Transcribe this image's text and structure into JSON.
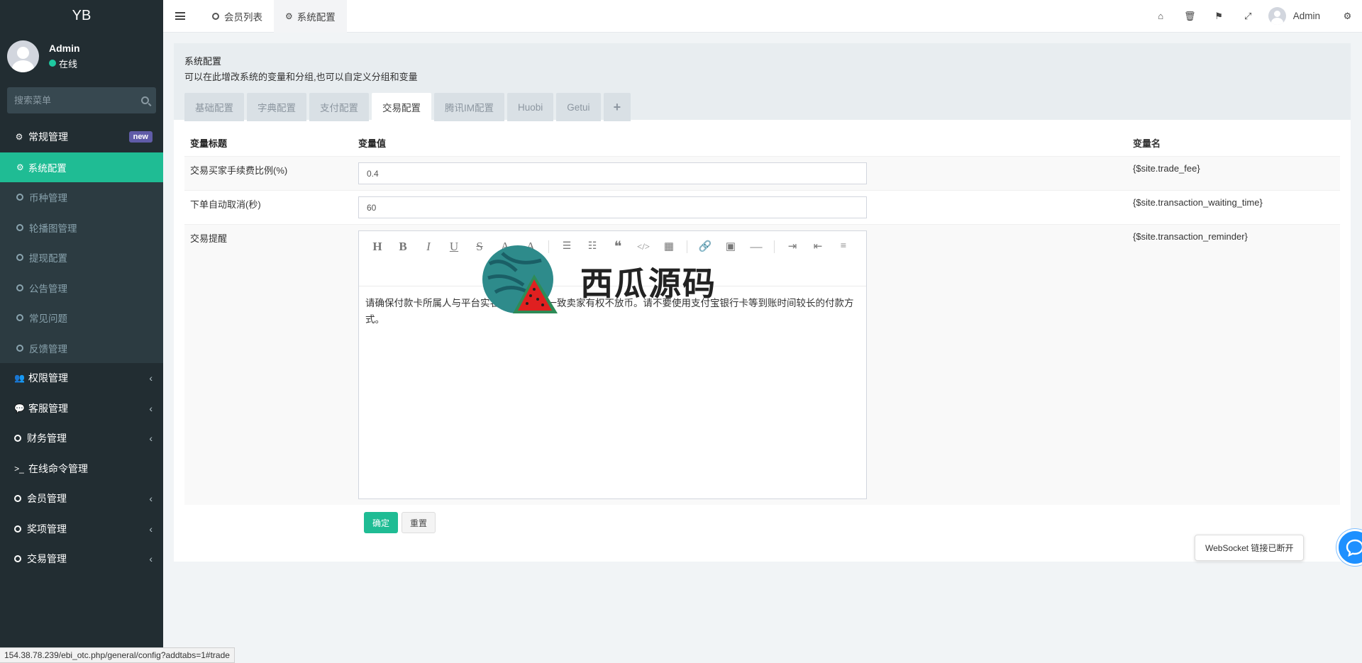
{
  "sidebar": {
    "logo": "YB",
    "user": {
      "name": "Admin",
      "status": "在线"
    },
    "search_placeholder": "搜索菜单",
    "group_regular": {
      "label": "常规管理",
      "badge": "new"
    },
    "sub_items": [
      {
        "label": "系统配置",
        "icon": "gear-icon",
        "active": true
      },
      {
        "label": "币种管理"
      },
      {
        "label": "轮播图管理"
      },
      {
        "label": "提现配置"
      },
      {
        "label": "公告管理"
      },
      {
        "label": "常见问题"
      },
      {
        "label": "反馈管理"
      }
    ],
    "items": [
      {
        "label": "权限管理",
        "icon": "users-icon",
        "chevron": "‹"
      },
      {
        "label": "客服管理",
        "icon": "comment-icon",
        "chevron": "‹"
      },
      {
        "label": "财务管理",
        "icon": "circle-icon",
        "chevron": "‹"
      },
      {
        "label": "在线命令管理",
        "icon": "terminal-icon"
      },
      {
        "label": "会员管理",
        "icon": "circle-icon",
        "chevron": "‹"
      },
      {
        "label": "奖项管理",
        "icon": "circle-icon",
        "chevron": "‹"
      },
      {
        "label": "交易管理",
        "icon": "circle-icon",
        "chevron": "‹"
      }
    ]
  },
  "topbar": {
    "tabs": [
      {
        "label": "会员列表",
        "icon": "circle-icon"
      },
      {
        "label": "系统配置",
        "icon": "gear-icon",
        "active": true
      }
    ],
    "user_name": "Admin"
  },
  "panel": {
    "title": "系统配置",
    "description": "可以在此增改系统的变量和分组,也可以自定义分组和变量",
    "tabs": [
      {
        "label": "基础配置"
      },
      {
        "label": "字典配置"
      },
      {
        "label": "支付配置"
      },
      {
        "label": "交易配置",
        "active": true
      },
      {
        "label": "腾讯IM配置"
      },
      {
        "label": "Huobi"
      },
      {
        "label": "Getui"
      },
      {
        "label": "+"
      }
    ],
    "table": {
      "headers": {
        "title": "变量标题",
        "value": "变量值",
        "name": "变量名"
      },
      "rows": [
        {
          "title": "交易买家手续费比例(%)",
          "value": "0.4",
          "name": "{$site.trade_fee}"
        },
        {
          "title": "下单自动取消(秒)",
          "value": "60",
          "name": "{$site.transaction_waiting_time}"
        },
        {
          "title": "交易提醒",
          "value": "请确保付款卡所属人与平台实名一致，若不一致卖家有权不放币。请不要使用支付宝银行卡等到账时间较长的付款方式。",
          "name": "{$site.transaction_reminder}"
        }
      ]
    },
    "buttons": {
      "confirm": "确定",
      "reset": "重置"
    }
  },
  "watermark": {
    "text": "西瓜源码"
  },
  "websocket": {
    "message": "WebSocket 链接已断开"
  },
  "statusbar": {
    "url": "154.38.78.239/ebi_otc.php/general/config?addtabs=1#trade"
  }
}
